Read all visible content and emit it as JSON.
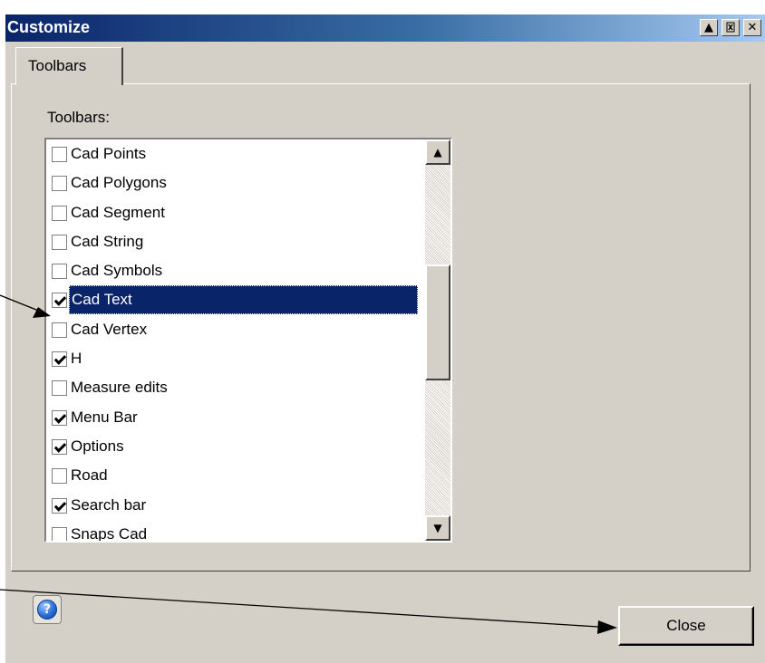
{
  "window": {
    "title": "Customize",
    "title_buttons": [
      {
        "glyph": "▲",
        "icon": "scroll-up-icon"
      },
      {
        "glyph": "ꟷ",
        "icon": "pin-icon"
      },
      {
        "glyph": "✕",
        "icon": "close-icon"
      }
    ]
  },
  "tabs": [
    {
      "label": "Toolbars"
    }
  ],
  "panel": {
    "label": "Toolbars:",
    "items": [
      {
        "label": "Cad Points",
        "checked": false
      },
      {
        "label": "Cad Polygons",
        "checked": false
      },
      {
        "label": "Cad Segment",
        "checked": false
      },
      {
        "label": "Cad String",
        "checked": false
      },
      {
        "label": "Cad Symbols",
        "checked": false
      },
      {
        "label": "Cad Text",
        "checked": true,
        "selected": true
      },
      {
        "label": "Cad Vertex",
        "checked": false
      },
      {
        "label": "H",
        "checked": true
      },
      {
        "label": "Measure edits",
        "checked": false
      },
      {
        "label": "Menu Bar",
        "checked": true
      },
      {
        "label": "Options",
        "checked": true
      },
      {
        "label": "Road",
        "checked": false
      },
      {
        "label": "Search bar",
        "checked": true
      },
      {
        "label": "Snaps Cad",
        "checked": false
      }
    ]
  },
  "footer": {
    "help_glyph": "?",
    "close_label": "Close"
  },
  "colors": {
    "dialog_face": "#d4d0c8",
    "selection": "#0a246a"
  }
}
